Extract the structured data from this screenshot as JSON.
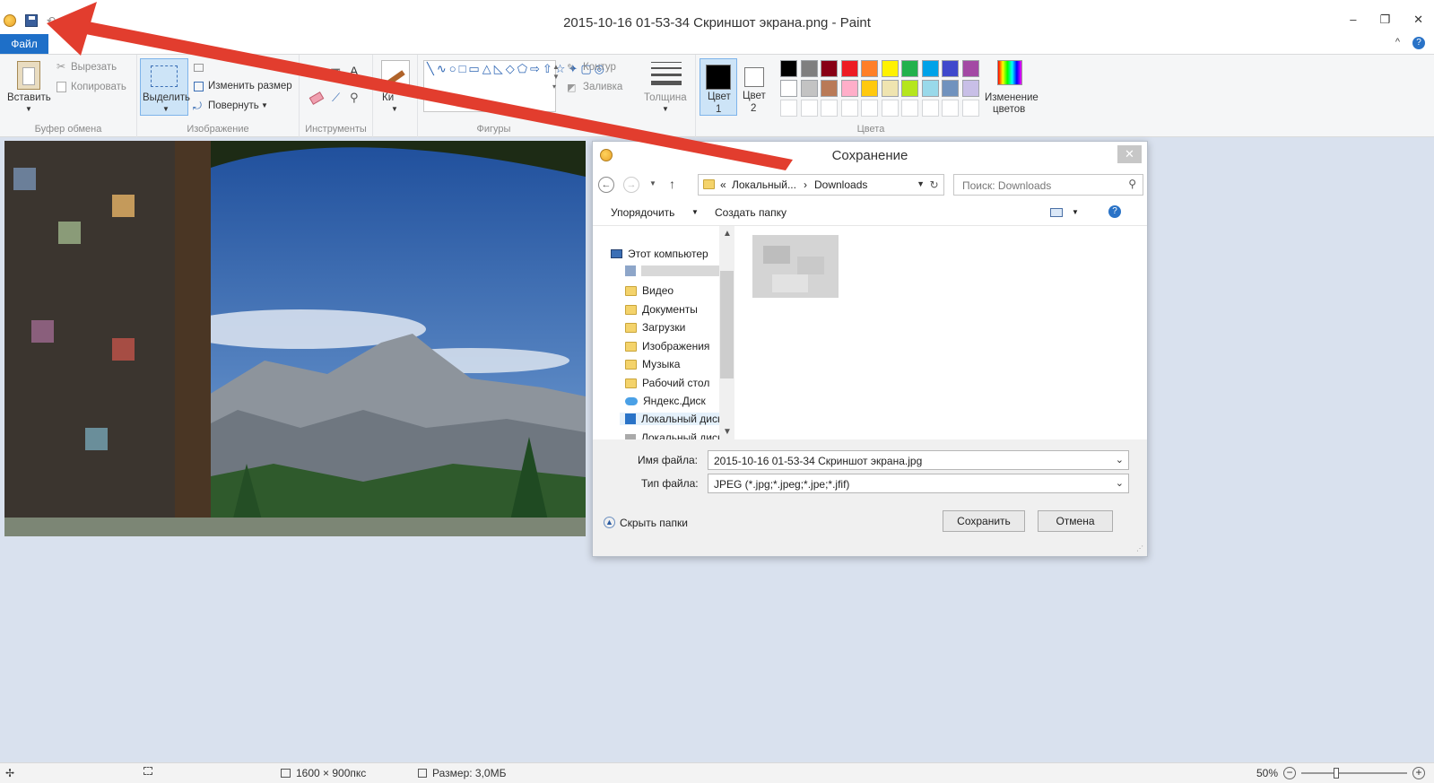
{
  "window": {
    "title": "2015-10-16 01-53-34 Скриншот экрана.png - Paint",
    "minimize": "–",
    "restore": "❐",
    "close": "✕"
  },
  "ribbon": {
    "file_tab": "Файл",
    "help_chevron": "^",
    "help_icon": "?",
    "clipboard": {
      "group_label": "Буфер обмена",
      "paste": "Вставить",
      "cut": "Вырезать",
      "copy": "Копировать"
    },
    "image": {
      "group_label": "Изображение",
      "select": "Выделить",
      "resize": "Изменить размер",
      "rotate": "Повернуть"
    },
    "tools": {
      "group_label": "Инструменты"
    },
    "brushes": {
      "label": "Ки"
    },
    "shapes": {
      "group_label": "Фигуры",
      "outline": "Контур",
      "fill": "Заливка"
    },
    "size": {
      "label": "Толщина"
    },
    "colors": {
      "group_label": "Цвета",
      "color1_label": "Цвет",
      "color1_num": "1",
      "color2_label": "Цвет",
      "color2_num": "2",
      "edit_colors": "Изменение",
      "edit_colors2": "цветов",
      "color1": "#000000",
      "color2": "#ffffff",
      "palette_row1": [
        "#000000",
        "#7f7f7f",
        "#880015",
        "#ed1c24",
        "#ff7f27",
        "#fff200",
        "#22b14c",
        "#00a2e8",
        "#3f48cc",
        "#a349a4"
      ],
      "palette_row2": [
        "#ffffff",
        "#c3c3c3",
        "#b97a57",
        "#ffaec9",
        "#ffc90e",
        "#efe4b0",
        "#b5e61d",
        "#99d9ea",
        "#7092be",
        "#c8bfe7"
      ]
    }
  },
  "status": {
    "dimensions": "1600 × 900пкс",
    "size": "Размер: 3,0МБ",
    "zoom": "50%"
  },
  "dialog": {
    "title": "Сохранение",
    "close": "✕",
    "address": {
      "chevrons": "«",
      "segment1": "Локальный...",
      "sep": "›",
      "segment2": "Downloads"
    },
    "search_placeholder": "Поиск: Downloads",
    "organize": "Упорядочить",
    "new_folder": "Создать папку",
    "tree": [
      "Этот компьютер",
      "Видео",
      "Документы",
      "Загрузки",
      "Изображения",
      "Музыка",
      "Рабочий стол",
      "Яндекс.Диск",
      "Локальный диск",
      "Локальный диск"
    ],
    "filename_label": "Имя файла:",
    "filename_value": "2015-10-16 01-53-34 Скриншот экрана.jpg",
    "filetype_label": "Тип файла:",
    "filetype_value": "JPEG (*.jpg;*.jpeg;*.jpe;*.jfif)",
    "hide_folders": "Скрыть папки",
    "save": "Сохранить",
    "cancel": "Отмена"
  }
}
